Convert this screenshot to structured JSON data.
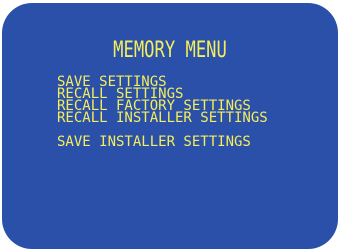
{
  "menu": {
    "title": "MEMORY MENU",
    "items": [
      {
        "label": "SAVE SETTINGS"
      },
      {
        "label": "RECALL SETTINGS"
      },
      {
        "label": "RECALL FACTORY SETTINGS"
      },
      {
        "label": "RECALL INSTALLER SETTINGS"
      },
      {
        "label": "SAVE INSTALLER SETTINGS"
      }
    ]
  },
  "colors": {
    "panel_background": "#2b50a9",
    "text": "#f4ee5c"
  }
}
